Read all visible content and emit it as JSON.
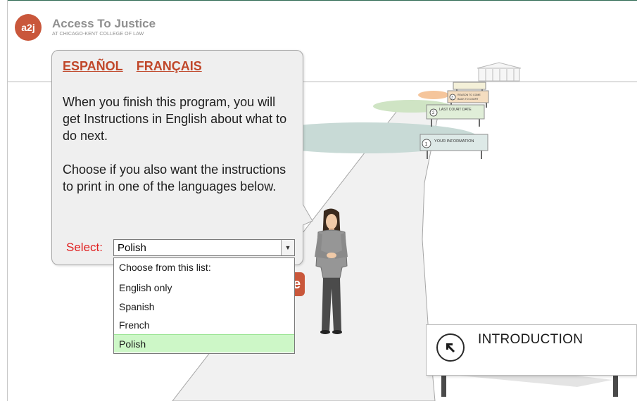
{
  "brand": {
    "logo_text": "a2j",
    "title": "Access To Justice",
    "subtitle": "AT CHICAGO-KENT COLLEGE OF LAW"
  },
  "bubble": {
    "languages": [
      "ESPAÑOL",
      "FRANÇAIS"
    ],
    "paragraph1": "When you finish this program, you will get Instructions in English about what to do next.",
    "paragraph2": "Choose if you also want the instructions to print in one of the languages below.",
    "select_label": "Select:",
    "select_value": "Polish",
    "options": [
      "Choose from this list:",
      "English only",
      "Spanish",
      "French",
      "Polish"
    ],
    "selected_index": 4
  },
  "behind_button_fragment": "e",
  "road_signs": [
    {
      "number": "1",
      "label": "YOUR INFORMATION"
    },
    {
      "number": "2",
      "label": "LAST COURT DATE"
    },
    {
      "number": "3",
      "label": "REASON TO COME BACK TO COURT"
    }
  ],
  "intro_sign": {
    "label": "INTRODUCTION",
    "icon": "arrow-up-left-icon"
  },
  "colors": {
    "accent": "#c9573b",
    "link": "#c0472a",
    "select_label": "#e02020",
    "selected_option": "#cdf7c7",
    "frame_top": "#2f6a54"
  }
}
